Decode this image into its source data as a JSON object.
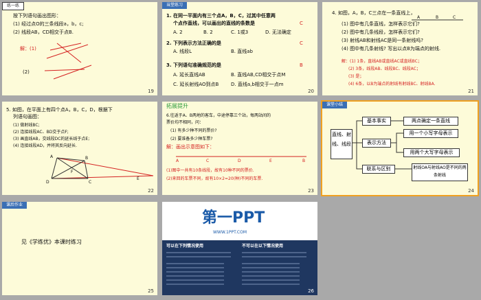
{
  "slides": [
    {
      "num": "19",
      "tag": "练一练",
      "lines": [
        "按下列语句画出图形：",
        "(1) 经过点O的三条线段a，b，c;",
        "(2) 线段AB，CD相交于点B."
      ],
      "answer_label": "解：(1)",
      "answer_label2": "(2)"
    },
    {
      "num": "20",
      "tag": "当堂练习",
      "q1": "1. 在同一平面内有三个点A，B，C，过其中任意两",
      "q1b": "个点作直线，可以画出的直线的条数是",
      "q1ans": "C",
      "q1opts": [
        "A. 2",
        "B. 2",
        "C. 1或3",
        "D. 无法确定"
      ],
      "q2": "2. 下列表示方法正确的是",
      "q2ans": "C",
      "q2opts": [
        "A. 线段L",
        "B. 直线ab"
      ],
      "q3": "3. 下列语句准确规范的是",
      "q3ans": "B",
      "q3opts": [
        "A. 延长直线AB",
        "B. 直线AB,CD相交于点M",
        "C. 延长射线AO到点B",
        "D. 直线a,b相交于一点m"
      ]
    },
    {
      "num": "21",
      "q": "4. 如图，A，B，C三点在一条直线上，",
      "items": [
        "(1) 图中有几条直线，怎样表示它们?",
        "(2) 图中有几条线段，怎样表示它们?",
        "(3) 射线AB和射线AC是同一条射线吗?",
        "(4) 图中有几条射线? 写出以点B为端点的射线."
      ],
      "answers": [
        "解：(1) 1条，直线AB或直线AC或直线BC；",
        "(2) 3条，线段AB、线段BC、线段AC；",
        "(3) 是；",
        "(4) 6条，以B为端点的射线有射线BC、射线BA."
      ],
      "labels": [
        "A",
        "B",
        "C"
      ]
    },
    {
      "num": "22",
      "q": "5. 如图，在平面上有四个点A，B，C，D，根据下",
      "q2": "列语句画图：",
      "items": [
        "(1) 做射线BC;",
        "(2) 连接线段AC、BD交于点F;",
        "(3) 画直线AB，交线段DC的延长线于点E;",
        "(4) 连接线段AD，并将其反向延长."
      ],
      "labels": [
        "A",
        "B",
        "C",
        "D",
        "E",
        "F"
      ]
    },
    {
      "num": "23",
      "tag": "拓展提升",
      "lines": [
        "6.往返于A、B两地的客车，中途停靠三个站，每两站间的",
        "票价均不相同，问：",
        "(1) 有多少种不同的票价?",
        "(2) 要准备多少种车票?"
      ],
      "ans_head": "解：画出示意图如下：",
      "pts": [
        "A",
        "C",
        "D",
        "E",
        "B"
      ],
      "ans1": "(1)图中一共有10条线段，故有10种不同的票价.",
      "ans2": "(2)来回的车票不同，故有10×2=20(种)不同的车票."
    },
    {
      "num": "24",
      "tag": "课堂小结",
      "left": "直线、射线、线段",
      "b1": "基本事实",
      "b1r": "两点确定一条直线",
      "b2": "表示方法",
      "b2r1": "用一个小写字母表示",
      "b2r2": "用两个大写字母表示",
      "b3": "联系与区别",
      "b3r": "射线OA与射线AO是不同的两条射线"
    },
    {
      "num": "25",
      "tag": "课后作业",
      "text": "见《学练优》本课时练习"
    },
    {
      "num": "26",
      "logo": "第一PPT",
      "url": "WWW.1PPT.COM",
      "c1": "可以在下列情况使用",
      "c2": "不可以在以下情况使用"
    }
  ]
}
